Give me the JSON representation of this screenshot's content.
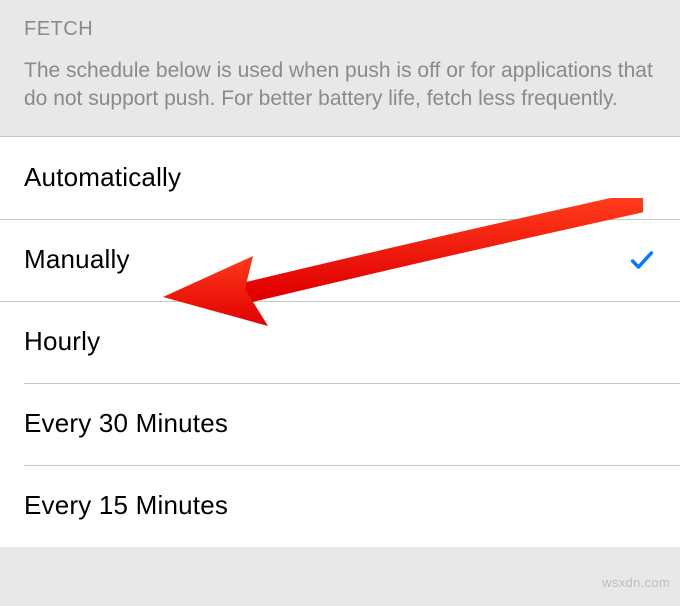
{
  "section": {
    "title": "FETCH",
    "description": "The schedule below is used when push is off or for applications that do not support push. For better battery life, fetch less frequently."
  },
  "options": [
    {
      "label": "Automatically",
      "selected": false
    },
    {
      "label": "Manually",
      "selected": true
    },
    {
      "label": "Hourly",
      "selected": false
    },
    {
      "label": "Every 30 Minutes",
      "selected": false
    },
    {
      "label": "Every 15 Minutes",
      "selected": false
    }
  ],
  "annotation": {
    "arrow_color": "#ff1a00",
    "target_option_index": 1
  },
  "watermark": "wsxdn.com"
}
